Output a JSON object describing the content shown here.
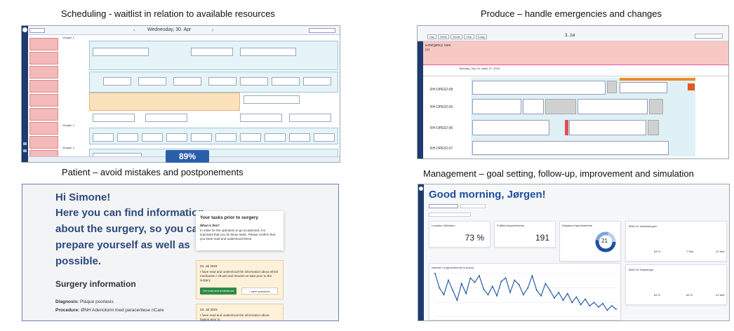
{
  "captions": {
    "scheduling": "Scheduling - waitlist in relation to available resources",
    "produce": "Produce – handle emergencies and changes",
    "patient": "Patient – avoid mistakes and postponements",
    "management": "Management – goal setting, follow-up, improvement and simulation"
  },
  "scheduling": {
    "date_title": "Wednesday, 30. Apr",
    "utilization": "89%",
    "group1": "Gruppe 1",
    "group2": "Gruppe 2",
    "group3": "Gruppe 3",
    "accent": "#2b5ea8"
  },
  "produce": {
    "date_title": "3. Jul",
    "emergency_label": "Emergency care",
    "emergency_count": "(0)",
    "day_label": "Monday, July 03, week 27, 2023",
    "rooms": [
      "RH-OPE02-08",
      "RH-OPE02-05",
      "RH-OPE02-06",
      "RH-OPE02-07"
    ],
    "tabs": [
      "Day",
      "Week",
      "Month",
      "Year",
      "Today"
    ]
  },
  "patient": {
    "greeting": "Hi Simone!",
    "intro_lines": [
      "Here you can find information",
      "about the surgery, so you can",
      "prepare yourself as well as",
      "possible."
    ],
    "section_title": "Surgery information",
    "diagnosis_label": "Diagnosis:",
    "diagnosis_value": "Plaque psoriasis",
    "procedure_label": "Procedure:",
    "procedure_value": "ØNH Adenotomi med paracentese nCare",
    "tasks_title": "Your tasks prior to surgery",
    "what_is_this": "What is this?",
    "tasks_desc": "In order for the operation to go as planned, it is important that you do these tasks. Please confirm that you have read and understood these.",
    "task1_date": "23. Jul 2023",
    "task1_text": "I have read and understood the information about which medication I should and should not take prior to the surgery",
    "confirm_btn": "I've read and understood",
    "questions_btn": "I have questions",
    "task2_date": "23. Jul 2023",
    "task2_text": "I have read and understood the information about fasting prior to"
  },
  "management": {
    "greeting": "Good morning, Jørgen!",
    "location_utilization": "Location Utilization",
    "location_value": "73 %",
    "fulfilled_appointments": "Fulfilled Appointments",
    "fulfilled_value": "191",
    "displaced_appointments": "Displaced Appointments",
    "displaced_value": "21",
    "queue_chart_title": "Number of appointments in queue",
    "right_card1": "ØNH-01 Vestreskogen",
    "right_card2": "ØNH-02 Dalsberget",
    "card1_values": [
      "63 %",
      "7 Slot",
      "41 Wet"
    ],
    "card2_values": [
      "63 %",
      "63 %",
      "41 Wet"
    ]
  },
  "chart_data": {
    "type": "line",
    "title": "Number of appointments in queue",
    "values": [
      78,
      52,
      40,
      66,
      48,
      30,
      60,
      42,
      70,
      62,
      74,
      50,
      40,
      55,
      38,
      64,
      70,
      44,
      66,
      58,
      40,
      52,
      74,
      48,
      38,
      60,
      48,
      34,
      44,
      30,
      42,
      26,
      36,
      22,
      32,
      20,
      26,
      18,
      24,
      12,
      20,
      14
    ]
  }
}
